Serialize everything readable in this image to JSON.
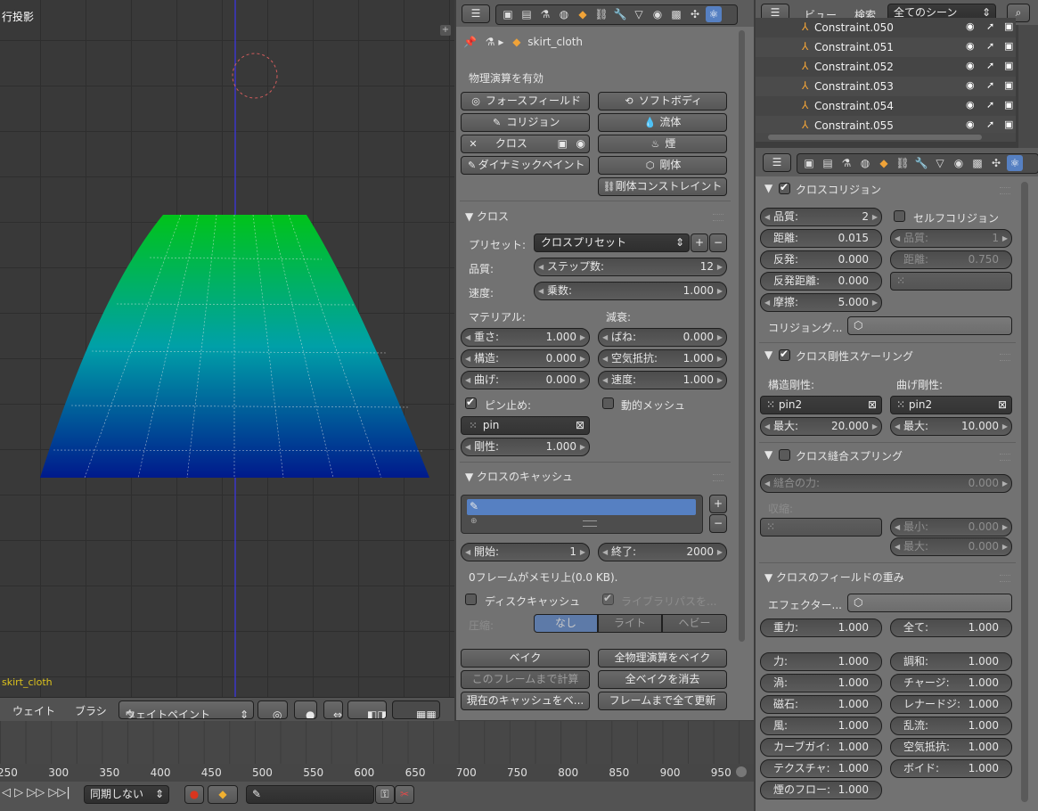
{
  "viewport": {
    "title": "行投影",
    "object_label": "skirt_cloth",
    "header": {
      "weight_menu": "ウェイト",
      "brush_menu": "ブラシ",
      "mode_select": "ウェイトペイント"
    }
  },
  "properties_left": {
    "context": {
      "object_name": "skirt_cloth"
    },
    "physics_section_title": "物理演算を有効",
    "physics_buttons": {
      "force_field": "フォースフィールド",
      "soft_body": "ソフトボディ",
      "collision": "コリジョン",
      "fluid": "流体",
      "cloth": "クロス",
      "smoke": "煙",
      "dynamic_paint": "ダイナミックペイント",
      "rigid_body": "剛体",
      "rigid_body_constraint": "剛体コンストレイント"
    },
    "cloth": {
      "title": "クロス",
      "preset_label": "プリセット:",
      "preset_value": "クロスプリセット",
      "quality_label": "品質:",
      "steps_label": "ステップ数:",
      "steps_value": "12",
      "speed_label": "速度:",
      "multiplier_label": "乗数:",
      "multiplier_value": "1.000",
      "material_label": "マテリアル:",
      "damping_label": "減衰:",
      "mass_label": "重さ:",
      "mass_value": "1.000",
      "structural_label": "構造:",
      "structural_value": "0.000",
      "bending_label": "曲げ:",
      "bending_value": "0.000",
      "spring_label": "ばね:",
      "spring_value": "0.000",
      "air_label": "空気抵抗:",
      "air_value": "1.000",
      "velocity_label": "速度:",
      "velocity_value": "1.000",
      "pinning_label": "ピン止め:",
      "dynamic_mesh_label": "動的メッシュ",
      "pin_group": "pin",
      "stiffness_label": "剛性:",
      "stiffness_value": "1.000"
    },
    "cache": {
      "title": "クロスのキャッシュ",
      "start_label": "開始:",
      "start_value": "1",
      "end_label": "終了:",
      "end_value": "2000",
      "info": "0フレームがメモリ上(0.0 KB).",
      "disk_cache_label": "ディスクキャッシュ",
      "library_path_label": "ライブラリパスを...",
      "compression_label": "圧縮:",
      "compression_options": [
        "なし",
        "ライト",
        "ヘビー"
      ],
      "bake_button": "ベイク",
      "bake_all_button": "全物理演算をベイク",
      "calc_to_frame_button": "このフレームまで計算",
      "free_all_bakes_button": "全ベイクを消去",
      "current_cache_to_bake_button": "現在のキャッシュをベ...",
      "update_all_to_frame_button": "フレームまで全て更新"
    }
  },
  "outliner": {
    "view_menu": "ビュー",
    "search_menu": "検索",
    "scene_select": "全てのシーン",
    "rows": [
      "Constraint.050",
      "Constraint.051",
      "Constraint.052",
      "Constraint.053",
      "Constraint.054",
      "Constraint.055"
    ]
  },
  "properties_right": {
    "collision": {
      "title": "クロスコリジョン",
      "quality_label": "品質:",
      "quality_value": "2",
      "self_collision_label": "セルフコリジョン",
      "distance_label": "距離:",
      "distance_value": "0.015",
      "self_quality_label": "品質:",
      "self_quality_value": "1",
      "repel_label": "反発:",
      "repel_value": "0.000",
      "self_distance_label": "距離:",
      "self_distance_value": "0.750",
      "repel_distance_label": "反発距離:",
      "repel_distance_value": "0.000",
      "friction_label": "摩擦:",
      "friction_value": "5.000",
      "collision_group_label": "コリジョング..."
    },
    "stiffness_scaling": {
      "title": "クロス剛性スケーリング",
      "structural_label": "構造剛性:",
      "bending_label": "曲げ剛性:",
      "structural_group": "pin2",
      "bending_group": "pin2",
      "structural_max_label": "最大:",
      "structural_max_value": "20.000",
      "bending_max_label": "最大:",
      "bending_max_value": "10.000"
    },
    "sewing": {
      "title": "クロス縫合スプリング",
      "force_label": "縫合の力:",
      "force_value": "0.000",
      "shrink_label": "収縮:",
      "min_label": "最小:",
      "min_value": "0.000",
      "max_label": "最大:",
      "max_value": "0.000"
    },
    "field_weights": {
      "title": "クロスのフィールドの重み",
      "effector_label": "エフェクター...",
      "rows": [
        [
          "重力:",
          "1.000",
          "全て:",
          "1.000"
        ],
        [
          "力:",
          "1.000",
          "調和:",
          "1.000"
        ],
        [
          "渦:",
          "1.000",
          "チャージ:",
          "1.000"
        ],
        [
          "磁石:",
          "1.000",
          "レナードジ:",
          "1.000"
        ],
        [
          "風:",
          "1.000",
          "乱流:",
          "1.000"
        ],
        [
          "カーブガイ:",
          "1.000",
          "空気抵抗:",
          "1.000"
        ],
        [
          "テクスチャ:",
          "1.000",
          "ボイド:",
          "1.000"
        ]
      ],
      "smoke_flow_label": "煙のフロー:",
      "smoke_flow_value": "1.000"
    }
  },
  "timeline": {
    "ticks": [
      "250",
      "300",
      "350",
      "400",
      "450",
      "500",
      "550",
      "600",
      "650",
      "700",
      "750",
      "800",
      "850",
      "900",
      "950"
    ],
    "sync_select": "同期しない"
  },
  "colors": {
    "accent": "#5680c2",
    "panel": "#727272",
    "viewport": "#393939",
    "mesh_top": "#00c31a",
    "mesh_bottom": "#001a8c"
  }
}
